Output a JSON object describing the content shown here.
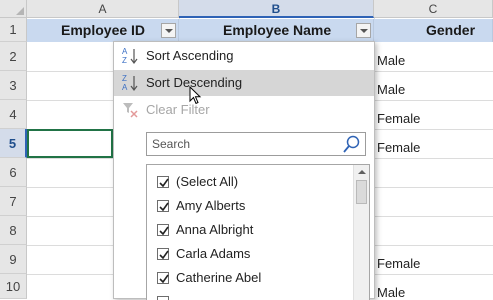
{
  "columns": [
    {
      "letter": "A",
      "header": "Employee ID"
    },
    {
      "letter": "B",
      "header": "Employee Name"
    },
    {
      "letter": "C",
      "header": "Gender"
    }
  ],
  "rows": [
    "1",
    "2",
    "3",
    "4",
    "5",
    "6",
    "7",
    "8",
    "9",
    "10"
  ],
  "gender_values": [
    "Male",
    "Male",
    "Female",
    "Female",
    "",
    "",
    "",
    "Female",
    "Male"
  ],
  "menu": {
    "sort_ascending": "Sort Ascending",
    "sort_descending": "Sort Descending",
    "clear_filter": "Clear Filter",
    "search_placeholder": "Search"
  },
  "filter_list": [
    {
      "label": "(Select All)",
      "checked": true
    },
    {
      "label": "Amy Alberts",
      "checked": true
    },
    {
      "label": "Anna Albright",
      "checked": true
    },
    {
      "label": "Carla Adams",
      "checked": true
    },
    {
      "label": "Catherine Abel",
      "checked": true
    },
    {
      "label": "",
      "checked": true
    }
  ],
  "colors": {
    "header_fill": "#c9d9ef",
    "active_heading": "#1f4e8c",
    "hover": "#d6d6d6",
    "sort_blue": "#3b6fc4",
    "sort_red": "#d9534f"
  },
  "icons": {
    "sort_ascending": "sort-az-icon",
    "sort_descending": "sort-za-icon",
    "clear_filter": "clear-filter-icon",
    "search": "search-icon",
    "checkbox": "checkmark-icon",
    "cursor": "mouse-pointer-icon"
  }
}
